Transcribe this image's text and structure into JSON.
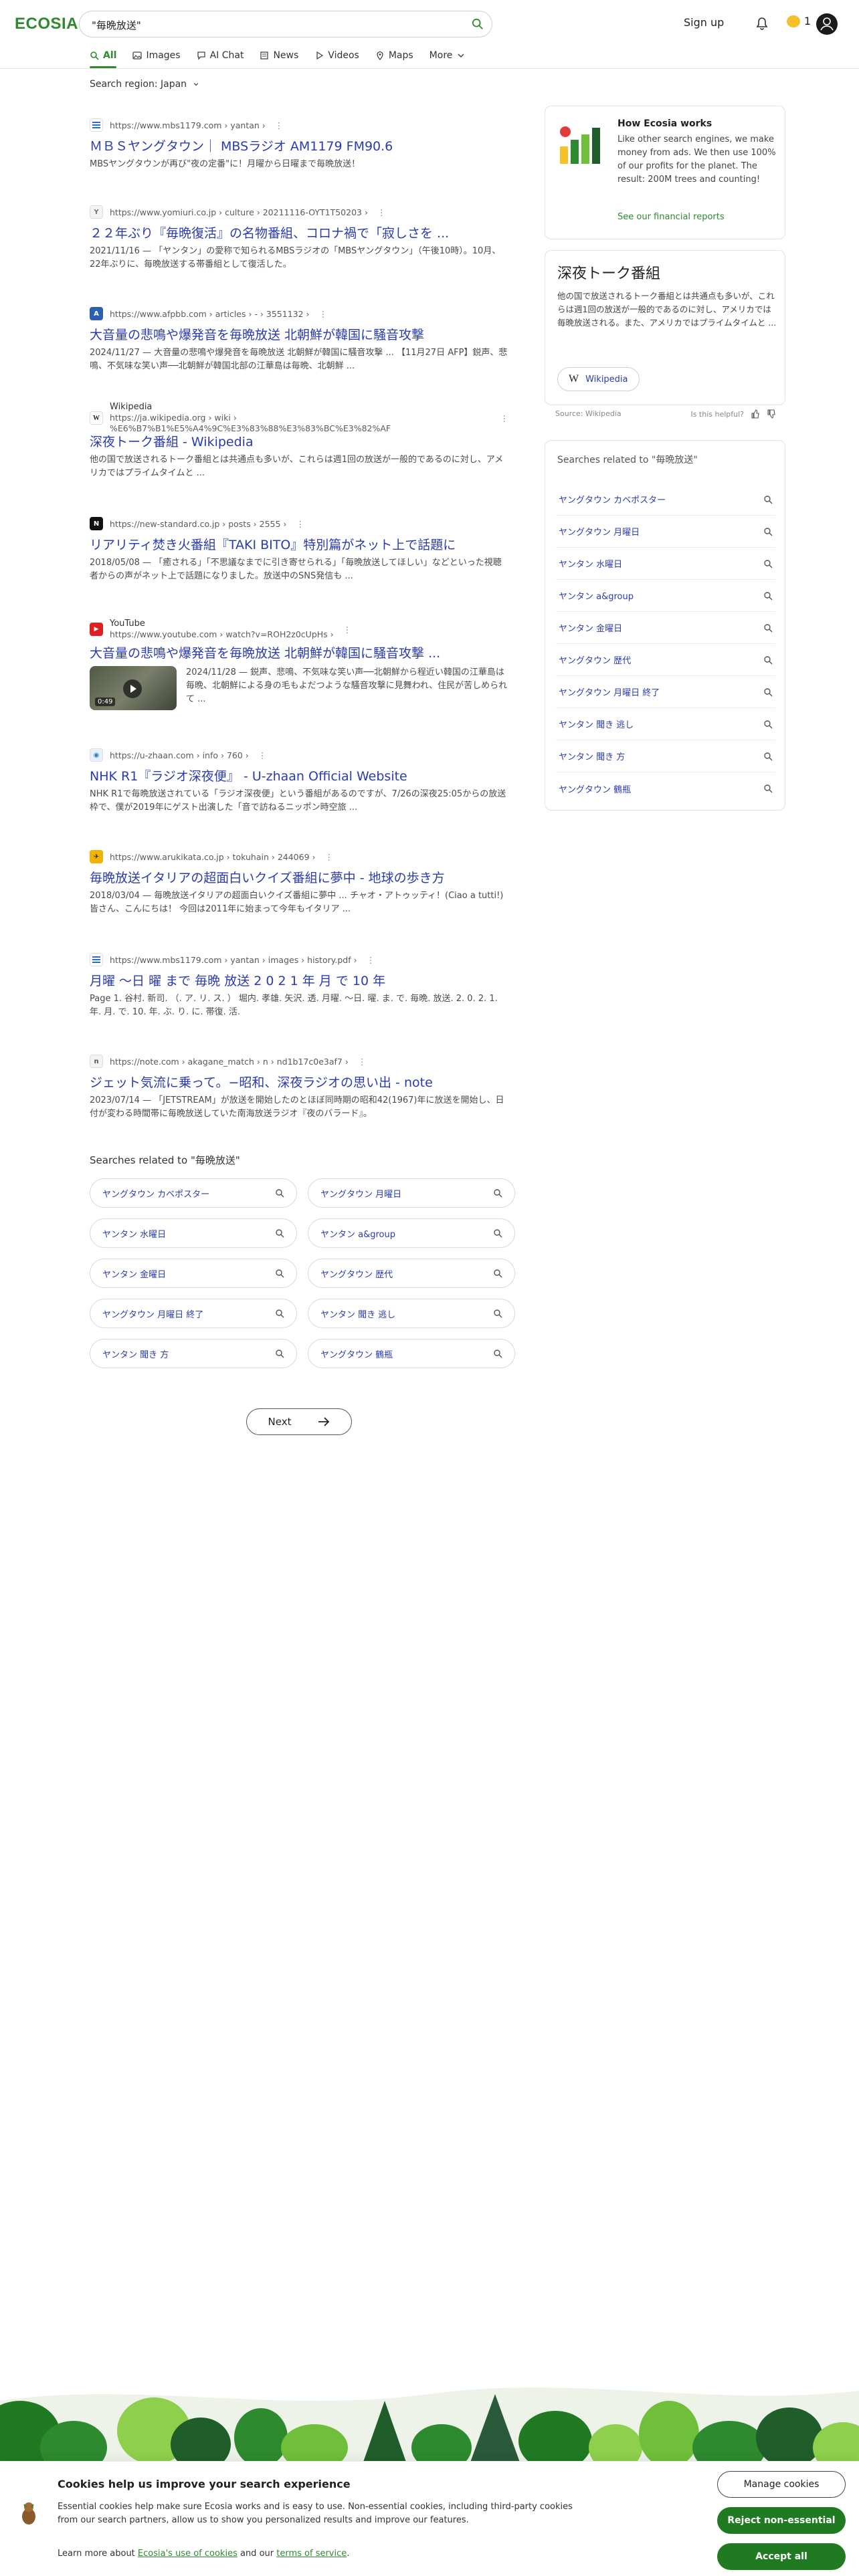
{
  "header": {
    "logo": "ECOSIA",
    "search_value": "\"毎晩放送\"",
    "signup": "Sign up",
    "tree_count": "1"
  },
  "tabs": [
    {
      "label": "All",
      "icon": "search-icon"
    },
    {
      "label": "Images",
      "icon": "image-icon"
    },
    {
      "label": "AI Chat",
      "icon": "chat-icon"
    },
    {
      "label": "News",
      "icon": "news-icon"
    },
    {
      "label": "Videos",
      "icon": "play-icon"
    },
    {
      "label": "Maps",
      "icon": "map-pin-icon"
    },
    {
      "label": "More",
      "icon": "chevron-down-icon"
    }
  ],
  "region": "Search region:  Japan",
  "results": [
    {
      "favicon": "M",
      "favicon_color": "#2b6fc4",
      "url": "https://www.mbs1179.com › yantan › ",
      "title": "ＭＢＳヤングタウン｜ MBSラジオ AM1179 FM90.6",
      "snippet": "MBSヤングタウンが再び\"夜の定番\"に！月曜から日曜まで毎晩放送！"
    },
    {
      "favicon": "Y",
      "favicon_color": "#9a9a9a",
      "url": "https://www.yomiuri.co.jp › culture › 20211116-OYT1T50203 › ",
      "title": "２２年ぶり『毎晩復活』の名物番組、コロナ禍で「寂しさを ...",
      "snippet": "2021/11/16 — 「ヤンタン」の愛称で知られるMBSラジオの「MBSヤングタウン」（午後10時）。10月、22年ぶりに、毎晩放送する帯番組として復活した。"
    },
    {
      "favicon": "A",
      "favicon_color": "#2b5fb0",
      "url": "https://www.afpbb.com › articles › - › 3551132 › ",
      "title": "大音量の悲鳴や爆発音を毎晩放送 北朝鮮が韓国に騒音攻撃",
      "snippet": "2024/11/27 — 大音量の悲鳴や爆発音を毎晩放送 北朝鮮が韓国に騒音攻撃 ... 【11月27日 AFP】鋭声、悲鳴、不気味な笑い声──北朝鮮が韓国北部の江華島は毎晩、北朝鮮 ..."
    },
    {
      "favicon": "W",
      "favicon_color": "#ffffff",
      "site_name": "Wikipedia",
      "url": "https://ja.wikipedia.org › wiki › %E6%B7%B1%E5%A4%9C%E3%83%88%E3%83%BC%E3%82%AF ",
      "title": "深夜トーク番組 - Wikipedia",
      "snippet": "他の国で放送されるトーク番組とは共通点も多いが、これらは週1回の放送が一般的であるのに対し、アメリカではプライムタイムと ..."
    },
    {
      "favicon": "N",
      "favicon_color": "#111111",
      "url": "https://new-standard.co.jp › posts › 2555 › ",
      "title": "リアリティ焚き火番組『TAKI BITO』特別篇がネット上で話題に",
      "snippet": "2018/05/08 — 「癒される」「不思議なまでに引き寄せられる」「毎晩放送してほしい」などといった視聴者からの声がネット上で話題になりました。放送中のSNS発信も ..."
    },
    {
      "favicon": "▶",
      "favicon_color": "#e02020",
      "site_name": "YouTube",
      "url": "https://www.youtube.com › watch?v=ROH2z0cUpHs › ",
      "title": "大音量の悲鳴や爆発音を毎晩放送 北朝鮮が韓国に騒音攻撃 ...",
      "snippet": "2024/11/28 — 鋭声、悲鳴、不気味な笑い声──北朝鮮から程近い韓国の江華島は毎晩、北朝鮮による身の毛もよだつような騒音攻撃に見舞われ、住民が苦しめられて ...",
      "duration": "0:49"
    },
    {
      "favicon": "U",
      "favicon_color": "#2b7bd0",
      "url": "https://u-zhaan.com › info › 760 › ",
      "title": "NHK R1『ラジオ深夜便』 - U-zhaan Official Website",
      "snippet": "NHK R1で毎晩放送されている「ラジオ深夜便」という番組があるのですが、7/26の深夜25:05からの放送枠で、僕が2019年にゲスト出演した「音で訪ねるニッポン時空旅 ..."
    },
    {
      "favicon": "✈",
      "favicon_color": "#f0b400",
      "url": "https://www.arukikata.co.jp › tokuhain › 244069 › ",
      "title": "毎晩放送イタリアの超面白いクイズ番組に夢中 - 地球の歩き方",
      "snippet": "2018/03/04 — 毎晩放送イタリアの超面白いクイズ番組に夢中 ... チャオ・アトゥッティ！(Ciao a tutti!) 皆さん、こんにちは！ 今回は2011年に始まって今年もイタリア ..."
    },
    {
      "favicon": "M",
      "favicon_color": "#2b6fc4",
      "url": "https://www.mbs1179.com › yantan › images › history.pdf › ",
      "title": "月曜 〜日 曜 まで 毎晩 放送 2 0 2 1 年 月 で 10 年",
      "snippet": "Page 1. 谷村. 新司. （. ア. リ. ス. ） 堀内. 孝雄. 矢沢. 透. 月曜. 〜日. 曜. ま. で. 毎晩. 放送. 2. 0. 2. 1. 年. 月. で. 10. 年. ぶ. り. に. 帯復. 活."
    },
    {
      "favicon": "n",
      "favicon_color": "#9a9a9a",
      "url": "https://note.com › akagane_match › n › nd1b17c0e3af7 › ",
      "title": "ジェット気流に乗って。−昭和、深夜ラジオの思い出 - note",
      "snippet": "2023/07/14 — 「JETSTREAM」が放送を開始したのとほぼ同時期の昭和42(1967)年に放送を開始し、日付が変わる時間帯に毎晩放送していた南海放送ラジオ『夜のバラード』。"
    }
  ],
  "related_heading": "Searches related to \"毎晩放送\"",
  "related": [
    "ヤングタウン カベポスター",
    "ヤングタウン 月曜日",
    "ヤンタン 水曜日",
    "ヤンタン a&group",
    "ヤンタン 金曜日",
    "ヤングタウン 歴代",
    "ヤングタウン 月曜日 終了",
    "ヤンタン 聞き 逃し",
    "ヤンタン 聞き 方",
    "ヤングタウン 鶴瓶"
  ],
  "next_label": "Next",
  "how_card": {
    "title": "How Ecosia works",
    "body": "Like other search engines, we make money from ads. We then use 100% of our profits for the planet. The result: 200M trees and counting!",
    "link": "See our financial reports"
  },
  "knowledge_panel": {
    "title": "深夜トーク番組",
    "body": "他の国で放送されるトーク番組とは共通点も多いが、これらは週1回の放送が一般的であるのに対し、アメリカでは毎晩放送される。また、アメリカではプライムタイムと ...",
    "button": "Wikipedia",
    "source": "Source: Wikipedia",
    "helpful": "Is this helpful?"
  },
  "side_related_heading": "Searches related to \"毎晩放送\"",
  "cookie": {
    "title": "Cookies help us improve your search experience",
    "body": "Essential cookies help make sure Ecosia works and is easy to use. Non-essential cookies, including third-party cookies from our search partners, allow us to show you personalized results and improve our features.",
    "learn_prefix": "Learn more about ",
    "link1": "Ecosia's use of cookies",
    "and": " and our ",
    "link2": "terms of service",
    "period": ".",
    "manage": "Manage cookies",
    "reject": "Reject non-essential",
    "accept": "Accept all"
  },
  "colors": {
    "brand_green": "#2d8a2f",
    "link_blue": "#2a3bb0"
  }
}
